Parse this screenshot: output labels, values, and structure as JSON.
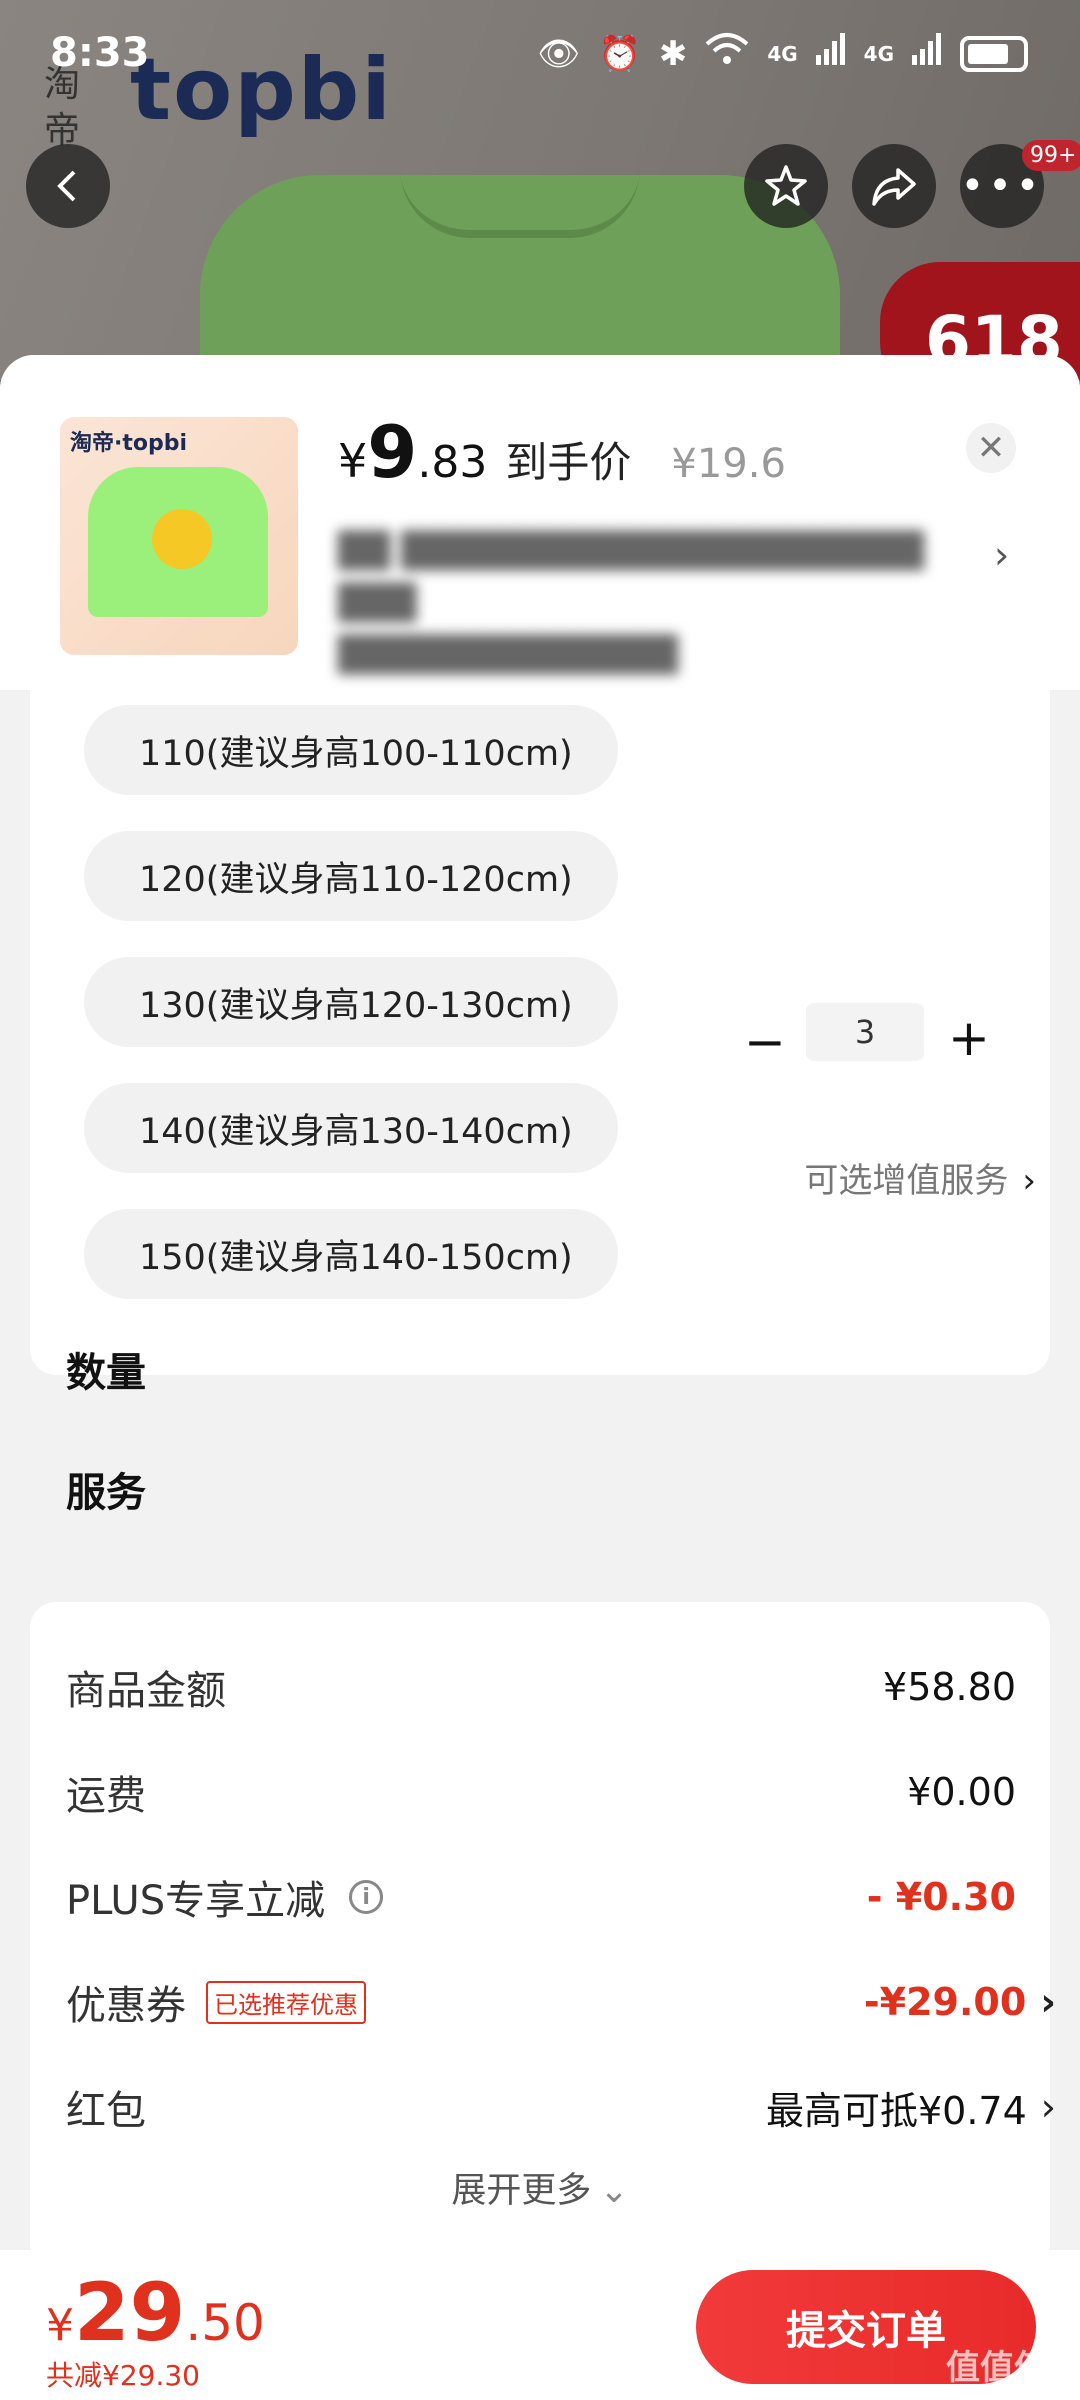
{
  "status_bar": {
    "time": "8:33",
    "net_label": "4G"
  },
  "background_page": {
    "brand": "topbi",
    "brand_cn": "淘帝",
    "promo": "618",
    "more_badge": "99+"
  },
  "header": {
    "thumb_logo": "淘帝·topbi",
    "price_symbol": "¥",
    "price_int": "9",
    "price_dec": ".83",
    "price_label": "到手价",
    "original_price": "¥19.6"
  },
  "sizes": [
    "110(建议身高100-110cm)",
    "120(建议身高110-120cm)",
    "130(建议身高120-130cm)",
    "140(建议身高130-140cm)",
    "150(建议身高140-150cm)"
  ],
  "quantity": {
    "label": "数量",
    "value": "3"
  },
  "service": {
    "label": "服务",
    "value": "可选增值服务"
  },
  "fees": {
    "goods_label": "商品金额",
    "goods_value": "¥58.80",
    "shipping_label": "运费",
    "shipping_value": "¥0.00",
    "plus_label": "PLUS专享立减",
    "plus_value": "- ¥0.30",
    "coupon_label": "优惠券",
    "coupon_tag": "已选推荐优惠",
    "coupon_value": "-¥29.00",
    "redpacket_label": "红包",
    "redpacket_value": "最高可抵¥0.74",
    "expand_label": "展开更多"
  },
  "bottom": {
    "total_symbol": "¥",
    "total_int": "29",
    "total_dec": ".50",
    "saved": "共减¥29.30",
    "submit": "提交订单"
  },
  "watermark": "值值值"
}
